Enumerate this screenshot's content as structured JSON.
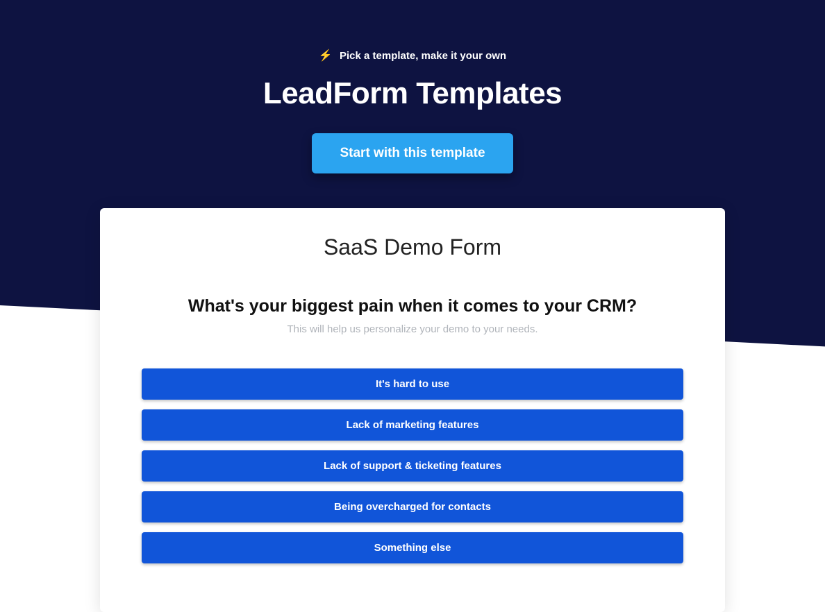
{
  "hero": {
    "eyebrow": "Pick a template, make it your own",
    "headline": "LeadForm Templates",
    "cta_label": "Start with this template"
  },
  "card": {
    "title": "SaaS Demo Form",
    "question": "What's your biggest pain when it comes to your CRM?",
    "subtext": "This will help us personalize your demo to your needs.",
    "options": [
      "It's hard to use",
      "Lack of marketing features",
      "Lack of support & ticketing features",
      "Being overcharged for contacts",
      "Something else"
    ]
  }
}
